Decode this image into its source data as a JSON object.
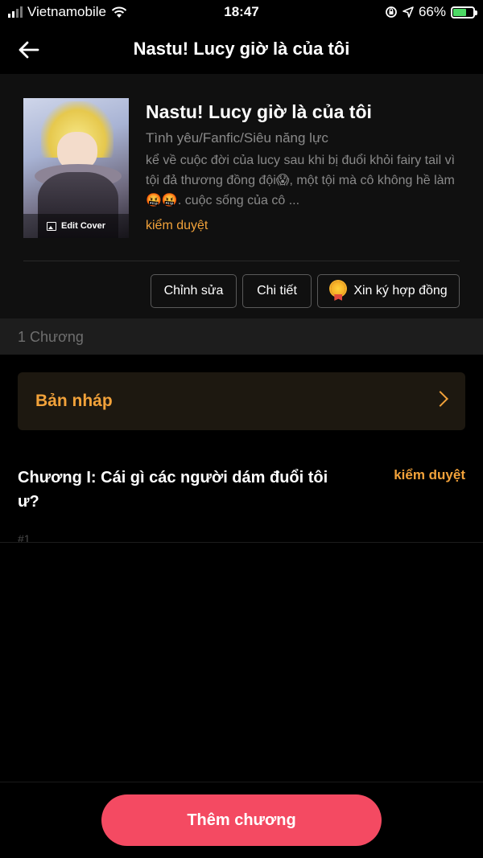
{
  "status_bar": {
    "carrier": "Vietnamobile",
    "time": "18:47",
    "battery_percent": "66%",
    "battery_level": 0.66,
    "icons": [
      "signal-icon",
      "wifi-icon",
      "orientation-lock-icon",
      "location-icon",
      "battery-charging-icon"
    ]
  },
  "nav": {
    "title": "Nastu! Lucy giờ là của tôi",
    "back_icon": "back-arrow-icon"
  },
  "book": {
    "cover_label": "Edit Cover",
    "title": "Nastu! Lucy giờ là của tôi",
    "genres": "Tình yêu/Fanfic/Siêu năng lực",
    "description": "kể về cuộc đời của lucy sau khi bị đuổi khỏi fairy tail vì tội đả thương đồng đội😱, một tội mà cô không hề làm🤬🤬. cuộc sống của cô ...",
    "status": "kiểm duyệt"
  },
  "actions": {
    "edit": "Chỉnh sửa",
    "details": "Chi tiết",
    "contract": "Xin ký hợp đồng"
  },
  "chapter_count": "1 Chương",
  "draft": {
    "label": "Bản nháp"
  },
  "chapters": [
    {
      "title": "Chương I: Cái gì các người dám đuổi tôi ư?",
      "status": "kiểm duyệt",
      "number": "#1"
    }
  ],
  "bottom": {
    "add_chapter": "Thêm chương"
  },
  "colors": {
    "accent_orange": "#f2a23a",
    "primary_button": "#f44a62",
    "background": "#000000"
  }
}
